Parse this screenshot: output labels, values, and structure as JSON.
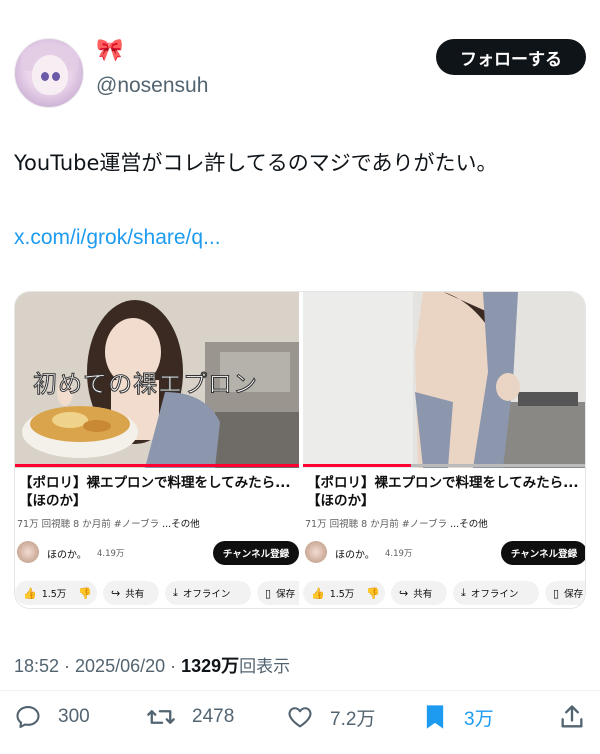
{
  "author": {
    "emoji": "🎀",
    "handle": "@nosensuh",
    "follow_label": "フォローする"
  },
  "tweet": {
    "text": "YouTube運営がコレ許してるのマジでありがたい。",
    "link": "x.com/i/grok/share/q..."
  },
  "videos": [
    {
      "overlay": "初めての裸エプロン",
      "title": "【ポロリ】裸エプロンで料理をしてみたら...【ほのか】",
      "meta": "71万 回視聴  8 か月前  #ノーブラ",
      "more": "...その他",
      "channel": "ほのか。",
      "subs": "4.19万",
      "subscribe": "チャンネル登録",
      "likes": "1.5万",
      "share": "共有",
      "offline": "オフライン",
      "save": "保存"
    },
    {
      "overlay": "",
      "title": "【ポロリ】裸エプロンで料理をしてみたら...【ほのか】",
      "meta": "71万 回視聴  8 か月前  #ノーブラ",
      "more": "...その他",
      "channel": "ほのか。",
      "subs": "4.19万",
      "subscribe": "チャンネル登録",
      "likes": "1.5万",
      "share": "共有",
      "offline": "オフライン",
      "save": "保存"
    }
  ],
  "footer": {
    "time": "18:52 · 2025/06/20 · ",
    "views": "1329万",
    "views_label": "回表示"
  },
  "stats": {
    "replies": "300",
    "reposts": "2478",
    "likes": "7.2万",
    "bookmarks": "3万"
  },
  "colors": {
    "accent": "#1d9bf0",
    "youtube_red": "#ff0033"
  }
}
